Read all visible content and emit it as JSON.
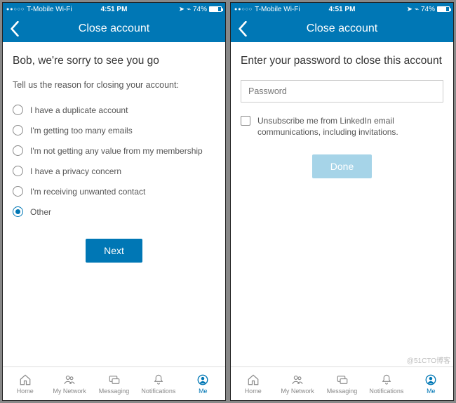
{
  "statusbar": {
    "carrier": "T-Mobile Wi-Fi",
    "time": "4:51 PM",
    "battery_pct": "74%"
  },
  "header": {
    "title": "Close account"
  },
  "left": {
    "heading": "Bob, we're sorry to see you go",
    "prompt": "Tell us the reason for closing your account:",
    "options": [
      "I have a duplicate account",
      "I'm getting too many emails",
      "I'm not getting any value from my membership",
      "I have a privacy concern",
      "I'm receiving unwanted contact",
      "Other"
    ],
    "selected_index": 5,
    "next_label": "Next"
  },
  "right": {
    "heading": "Enter your password to close this account",
    "password_placeholder": "Password",
    "unsubscribe_label": "Unsubscribe me from LinkedIn email communications, including invitations.",
    "done_label": "Done"
  },
  "tabs": {
    "items": [
      "Home",
      "My Network",
      "Messaging",
      "Notifications",
      "Me"
    ],
    "active_index": 4
  },
  "watermark": "@51CTO博客"
}
